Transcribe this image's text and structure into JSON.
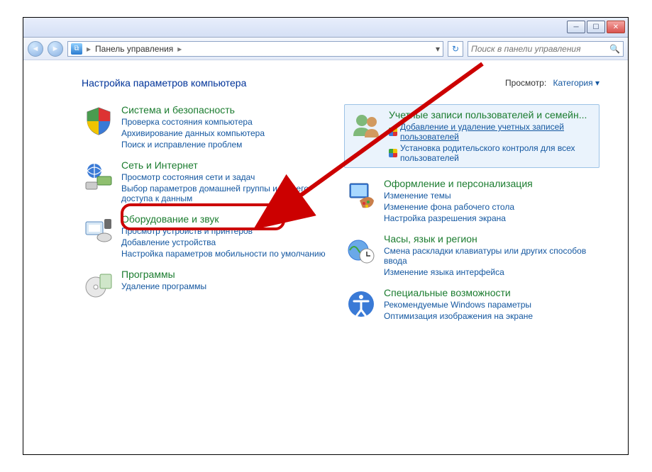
{
  "titlebar": {
    "minimize_tip": "Свернуть",
    "maximize_tip": "Развернуть",
    "close_tip": "Закрыть"
  },
  "toolbar": {
    "back_tip": "Назад",
    "forward_tip": "Вперёд",
    "breadcrumb_root": "Панель управления",
    "breadcrumb_arrow": "▸",
    "refresh_tip": "Обновить",
    "search_placeholder": "Поиск в панели управления"
  },
  "page": {
    "title": "Настройка параметров компьютера",
    "view_label": "Просмотр:",
    "view_value": "Категория"
  },
  "cats": {
    "sec": {
      "title": "Система и безопасность",
      "l1": "Проверка состояния компьютера",
      "l2": "Архивирование данных компьютера",
      "l3": "Поиск и исправление проблем"
    },
    "net": {
      "title": "Сеть и Интернет",
      "l1": "Просмотр состояния сети и задач",
      "l2": "Выбор параметров домашней группы и общего доступа к данным"
    },
    "hw": {
      "title": "Оборудование и звук",
      "l1": "Просмотр устройств и принтеров",
      "l2": "Добавление устройства",
      "l3": "Настройка параметров мобильности по умолчанию"
    },
    "prog": {
      "title": "Программы",
      "l1": "Удаление программы"
    },
    "users": {
      "title": "Учетные записи пользователей и семейн...",
      "l1": "Добавление и удаление учетных записей пользователей",
      "l2": "Установка родительского контроля для всех пользователей"
    },
    "pers": {
      "title": "Оформление и персонализация",
      "l1": "Изменение темы",
      "l2": "Изменение фона рабочего стола",
      "l3": "Настройка разрешения экрана"
    },
    "clock": {
      "title": "Часы, язык и регион",
      "l1": "Смена раскладки клавиатуры или других способов ввода",
      "l2": "Изменение языка интерфейса"
    },
    "ease": {
      "title": "Специальные возможности",
      "l1": "Рекомендуемые Windows параметры",
      "l2": "Оптимизация изображения на экране"
    }
  }
}
